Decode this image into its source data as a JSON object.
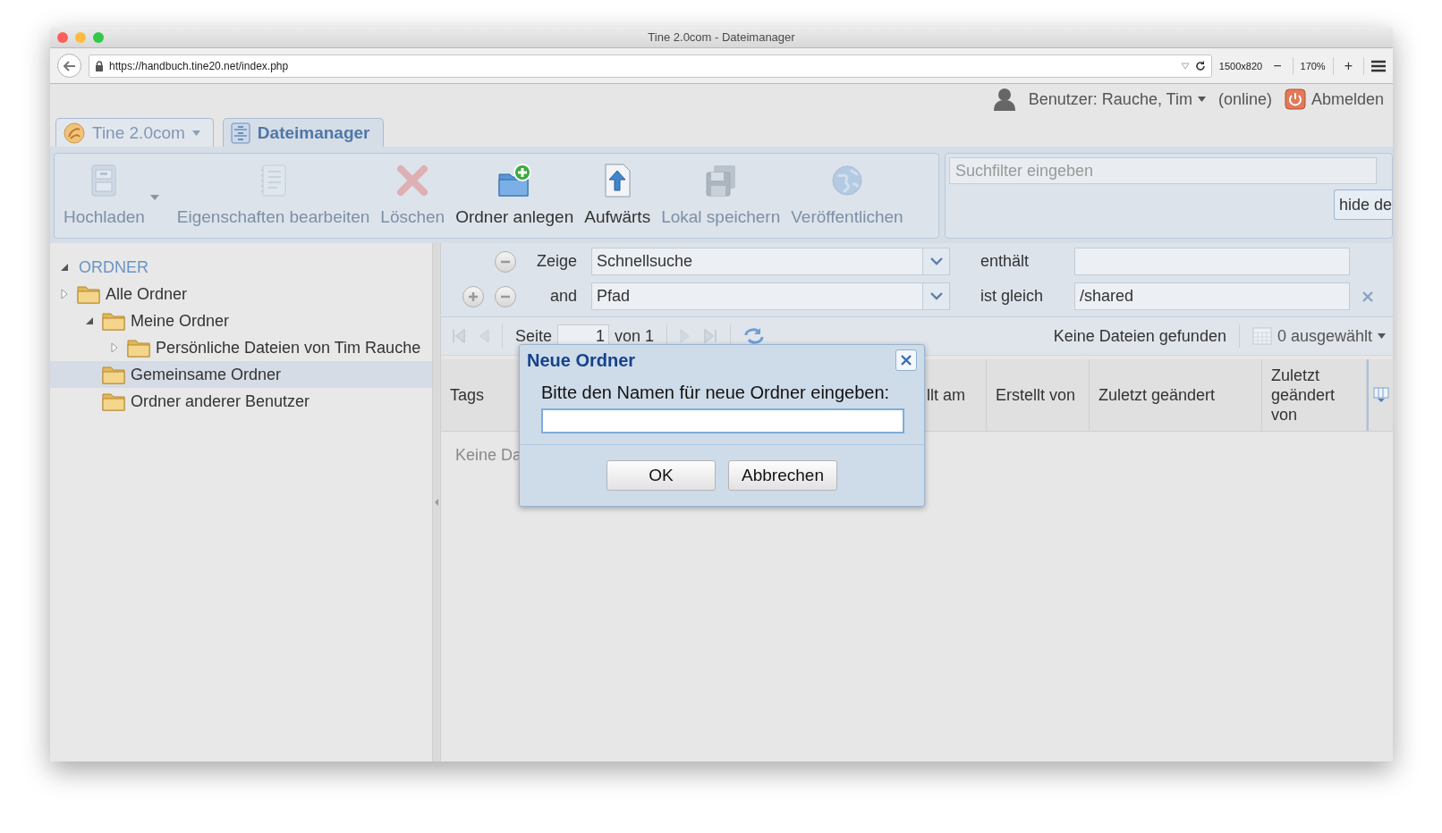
{
  "window": {
    "title": "Tine 2.0com - Dateimanager"
  },
  "browser": {
    "url": "https://handbuch.tine20.net/index.php",
    "viewport": "1500x820",
    "zoom_out": "−",
    "zoom": "170%",
    "zoom_in": "+"
  },
  "user_bar": {
    "user": "Benutzer: Rauche, Tim",
    "status": "(online)",
    "logout": "Abmelden"
  },
  "app_tabs": [
    {
      "label": "Tine 2.0com",
      "kind": "app",
      "selected": false
    },
    {
      "label": "Dateimanager",
      "kind": "module",
      "selected": true
    }
  ],
  "toolbar": [
    {
      "label": "Hochladen",
      "kind": "upload",
      "disabled": true,
      "menu": true
    },
    {
      "label": "Eigenschaften bearbeiten",
      "kind": "properties",
      "disabled": true
    },
    {
      "label": "Löschen",
      "kind": "delete",
      "disabled": true
    },
    {
      "label": "Ordner anlegen",
      "kind": "folder",
      "disabled": false
    },
    {
      "label": "Aufwärts",
      "kind": "up",
      "disabled": false
    },
    {
      "label": "Lokal speichern",
      "kind": "save",
      "disabled": true
    },
    {
      "label": "Veröffentlichen",
      "kind": "publish",
      "disabled": true
    }
  ],
  "search": {
    "placeholder": "Suchfilter eingeben",
    "button": "hide de"
  },
  "tree": {
    "label": "ORDNER",
    "expanded": true,
    "selected": false,
    "children": [
      {
        "label": "Alle Ordner",
        "expanded": false,
        "selected": false,
        "children": [
          {
            "label": "Meine Ordner",
            "expanded": true,
            "selected": false,
            "children": [
              {
                "label": "Persönliche Dateien von Tim Rauche",
                "expanded": false,
                "selected": false
              }
            ]
          },
          {
            "label": "Gemeinsame Ordner",
            "selected": true
          },
          {
            "label": "Ordner anderer Benutzer",
            "selected": false
          }
        ]
      }
    ]
  },
  "filters": [
    {
      "label": "Zeige",
      "add": false,
      "field": "Schnellsuche",
      "operator": "enthält"
    },
    {
      "label": "and",
      "add": true,
      "field": "Pfad",
      "operator": "ist gleich",
      "value": "/shared"
    }
  ],
  "pager": {
    "page_label": "Seite",
    "page": "1",
    "of": "von 1",
    "status": "Keine Dateien gefunden",
    "selection": "0 ausgewählt"
  },
  "grid": {
    "columns": [
      "Tags",
      "llt am",
      "Erstellt von",
      "Zuletzt geändert",
      "Zuletzt geändert von"
    ],
    "empty_text": "Keine Da"
  },
  "dialog": {
    "title": "Neue Ordner",
    "prompt": "Bitte den Namen für neue Ordner eingeben:",
    "buttons": [
      "OK",
      "Abbrechen"
    ]
  }
}
